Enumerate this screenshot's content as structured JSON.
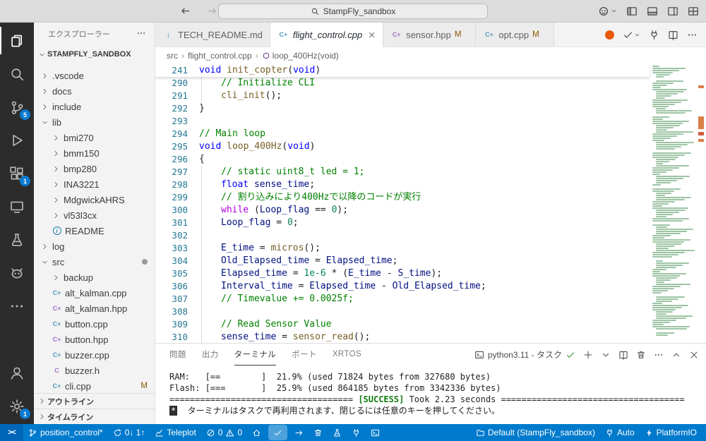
{
  "colors": {
    "status_bar": "#007acc",
    "activity_badge": "#0a7ad1",
    "git_modified": "#895503",
    "terminal_success": "#107c10",
    "tab_action_orange": "#e8590c"
  },
  "title_bar": {
    "search_value": "StampFly_sandbox",
    "nav": [
      {
        "name": "nav-back",
        "icon": "arrow-left-icon"
      },
      {
        "name": "nav-forward",
        "icon": "arrow-right-icon",
        "disabled": true
      }
    ],
    "right_actions": [
      {
        "name": "copilot-menu",
        "icon": "copilot-icon",
        "chevron": true
      },
      {
        "name": "toggle-primary-sidebar",
        "icon": "layout-sidebar-icon"
      },
      {
        "name": "toggle-panel",
        "icon": "layout-panel-icon"
      },
      {
        "name": "toggle-secondary-sidebar",
        "icon": "layout-sidebar-right-icon"
      },
      {
        "name": "customize-layout",
        "icon": "layout-grid-icon"
      }
    ]
  },
  "activity_bar": {
    "top": [
      {
        "name": "explorer",
        "icon": "files-icon",
        "active": true
      },
      {
        "name": "search",
        "icon": "search-icon"
      },
      {
        "name": "source-control",
        "icon": "source-control-icon",
        "badge": "5"
      },
      {
        "name": "run-and-debug",
        "icon": "run-debug-icon"
      },
      {
        "name": "extensions",
        "icon": "extensions-icon",
        "badge": "1"
      },
      {
        "name": "remote-explorer",
        "icon": "remote-explorer-icon"
      },
      {
        "name": "testing",
        "icon": "beaker-icon"
      },
      {
        "name": "platformio",
        "icon": "platformio-bug-icon"
      },
      {
        "name": "additional-views",
        "icon": "ellipsis-icon"
      }
    ],
    "bottom": [
      {
        "name": "accounts",
        "icon": "account-icon"
      },
      {
        "name": "settings",
        "icon": "gear-icon",
        "badge": "1"
      }
    ]
  },
  "sidebar": {
    "title": "エクスプローラー",
    "section": {
      "label": "STAMPFLY_SANDBOX",
      "state": "expanded"
    },
    "tree": [
      {
        "label": ".vscode",
        "kind": "folder",
        "state": "collapsed",
        "level": 1
      },
      {
        "label": "docs",
        "kind": "folder",
        "state": "collapsed",
        "level": 1
      },
      {
        "label": "include",
        "kind": "folder",
        "state": "collapsed",
        "level": 1
      },
      {
        "label": "lib",
        "kind": "folder",
        "state": "expanded",
        "level": 1
      },
      {
        "label": "bmi270",
        "kind": "folder",
        "state": "collapsed",
        "level": 2
      },
      {
        "label": "bmm150",
        "kind": "folder",
        "state": "collapsed",
        "level": 2
      },
      {
        "label": "bmp280",
        "kind": "folder",
        "state": "collapsed",
        "level": 2
      },
      {
        "label": "INA3221",
        "kind": "folder",
        "state": "collapsed",
        "level": 2
      },
      {
        "label": "MdgwickAHRS",
        "kind": "folder",
        "state": "collapsed",
        "level": 2
      },
      {
        "label": "vl53l3cx",
        "kind": "folder",
        "state": "collapsed",
        "level": 2
      },
      {
        "label": "README",
        "kind": "file",
        "icon": "info-icon",
        "level": 2
      },
      {
        "label": "log",
        "kind": "folder",
        "state": "collapsed",
        "level": 1
      },
      {
        "label": "src",
        "kind": "folder",
        "state": "expanded",
        "level": 1,
        "dot": true
      },
      {
        "label": "backup",
        "kind": "folder",
        "state": "collapsed",
        "level": 2
      },
      {
        "label": "alt_kalman.cpp",
        "kind": "file",
        "icon": "cpp-file-icon",
        "level": 2
      },
      {
        "label": "alt_kalman.hpp",
        "kind": "file",
        "icon": "hpp-file-icon",
        "level": 2
      },
      {
        "label": "button.cpp",
        "kind": "file",
        "icon": "cpp-file-icon",
        "level": 2
      },
      {
        "label": "button.hpp",
        "kind": "file",
        "icon": "hpp-file-icon",
        "level": 2
      },
      {
        "label": "buzzer.cpp",
        "kind": "file",
        "icon": "cpp-file-icon",
        "level": 2
      },
      {
        "label": "buzzer.h",
        "kind": "file",
        "icon": "h-file-icon",
        "level": 2
      },
      {
        "label": "cli.cpp",
        "kind": "file",
        "icon": "cpp-file-icon",
        "level": 2,
        "badge": "M"
      }
    ],
    "bottom_sections": [
      {
        "label": "アウトライン"
      },
      {
        "label": "タイムライン"
      }
    ]
  },
  "editor_tabs": {
    "tabs": [
      {
        "label": "TECH_README.md",
        "icon": "markdown-file-icon",
        "state": "inactive"
      },
      {
        "label": "flight_control.cpp",
        "icon": "cpp-file-icon",
        "state": "active",
        "preview": true,
        "closable": true
      },
      {
        "label": "sensor.hpp",
        "icon": "hpp-file-icon",
        "state": "inactive",
        "modified": "M"
      },
      {
        "label": "opt.cpp",
        "icon": "cpp-file-icon",
        "state": "inactive",
        "modified": "M"
      }
    ],
    "actions": [
      {
        "name": "platformio-task-indicator",
        "icon": "orange-circle-icon"
      },
      {
        "name": "run-build-task",
        "icon": "check-icon",
        "chevron": true
      },
      {
        "name": "pio-upload",
        "icon": "plug-icon"
      },
      {
        "name": "split-editor",
        "icon": "split-icon"
      },
      {
        "name": "more-editor-actions",
        "icon": "ellipsis-icon"
      }
    ]
  },
  "breadcrumb": {
    "items": [
      {
        "label": "src"
      },
      {
        "label": "flight_control.cpp"
      },
      {
        "label": "loop_400Hz(void)",
        "icon": "symbol-method-icon"
      }
    ]
  },
  "editor": {
    "sticky_line": {
      "n": "241",
      "i": 0,
      "t": [
        [
          "kw",
          "void"
        ],
        [
          "plain",
          " "
        ],
        [
          "fn",
          "init_copter"
        ],
        [
          "plain",
          "("
        ],
        [
          "kw",
          "void"
        ],
        [
          "plain",
          ")"
        ]
      ]
    },
    "lines": [
      {
        "n": "290",
        "i": 1,
        "t": [
          [
            "comment",
            "// Initialize CLI"
          ]
        ]
      },
      {
        "n": "291",
        "i": 1,
        "t": [
          [
            "fn",
            "cli_init"
          ],
          [
            "plain",
            "();"
          ]
        ]
      },
      {
        "n": "292",
        "i": 0,
        "t": [
          [
            "plain",
            "}"
          ]
        ]
      },
      {
        "n": "293",
        "i": 0,
        "t": []
      },
      {
        "n": "294",
        "i": 0,
        "t": [
          [
            "comment",
            "// Main loop"
          ]
        ]
      },
      {
        "n": "295",
        "i": 0,
        "t": [
          [
            "kw",
            "void"
          ],
          [
            "plain",
            " "
          ],
          [
            "fn",
            "loop_400Hz"
          ],
          [
            "plain",
            "("
          ],
          [
            "kw",
            "void"
          ],
          [
            "plain",
            ")"
          ]
        ]
      },
      {
        "n": "296",
        "i": 0,
        "t": [
          [
            "plain",
            "{"
          ]
        ]
      },
      {
        "n": "297",
        "i": 1,
        "t": [
          [
            "comment",
            "// static uint8_t led = 1;"
          ]
        ]
      },
      {
        "n": "298",
        "i": 1,
        "t": [
          [
            "kw",
            "float"
          ],
          [
            "plain",
            " "
          ],
          [
            "var",
            "sense_time"
          ],
          [
            "plain",
            ";"
          ]
        ]
      },
      {
        "n": "299",
        "i": 1,
        "t": [
          [
            "comment",
            "// 割り込みにより400Hzで以降のコードが実行"
          ]
        ]
      },
      {
        "n": "300",
        "i": 1,
        "t": [
          [
            "ctrl",
            "while"
          ],
          [
            "plain",
            " ("
          ],
          [
            "var",
            "Loop_flag"
          ],
          [
            "plain",
            " == "
          ],
          [
            "num",
            "0"
          ],
          [
            "plain",
            ");"
          ]
        ]
      },
      {
        "n": "301",
        "i": 1,
        "t": [
          [
            "var",
            "Loop_flag"
          ],
          [
            "plain",
            " = "
          ],
          [
            "num",
            "0"
          ],
          [
            "plain",
            ";"
          ]
        ]
      },
      {
        "n": "302",
        "i": 1,
        "t": []
      },
      {
        "n": "303",
        "i": 1,
        "t": [
          [
            "var",
            "E_time"
          ],
          [
            "plain",
            " = "
          ],
          [
            "fn",
            "micros"
          ],
          [
            "plain",
            "();"
          ]
        ]
      },
      {
        "n": "304",
        "i": 1,
        "t": [
          [
            "var",
            "Old_Elapsed_time"
          ],
          [
            "plain",
            " = "
          ],
          [
            "var",
            "Elapsed_time"
          ],
          [
            "plain",
            ";"
          ]
        ]
      },
      {
        "n": "305",
        "i": 1,
        "t": [
          [
            "var",
            "Elapsed_time"
          ],
          [
            "plain",
            " = "
          ],
          [
            "num",
            "1e-6"
          ],
          [
            "plain",
            " * ("
          ],
          [
            "var",
            "E_time"
          ],
          [
            "plain",
            " - "
          ],
          [
            "var",
            "S_time"
          ],
          [
            "plain",
            ");"
          ]
        ]
      },
      {
        "n": "306",
        "i": 1,
        "t": [
          [
            "var",
            "Interval_time"
          ],
          [
            "plain",
            " = "
          ],
          [
            "var",
            "Elapsed_time"
          ],
          [
            "plain",
            " - "
          ],
          [
            "var",
            "Old_Elapsed_time"
          ],
          [
            "plain",
            ";"
          ]
        ]
      },
      {
        "n": "307",
        "i": 1,
        "t": [
          [
            "comment",
            "// Timevalue += 0.0025f;"
          ]
        ]
      },
      {
        "n": "308",
        "i": 1,
        "t": []
      },
      {
        "n": "309",
        "i": 1,
        "t": [
          [
            "comment",
            "// Read Sensor Value"
          ]
        ]
      },
      {
        "n": "310",
        "i": 1,
        "t": [
          [
            "var",
            "sense_time"
          ],
          [
            "plain",
            " = "
          ],
          [
            "fn",
            "sensor_read"
          ],
          [
            "plain",
            "();"
          ]
        ]
      }
    ]
  },
  "panel": {
    "tabs": [
      {
        "label": "問題"
      },
      {
        "label": "出力"
      },
      {
        "label": "ターミナル",
        "active": true
      },
      {
        "label": "ポート"
      },
      {
        "label": "XRTOS"
      }
    ],
    "task": {
      "icon": "terminal-icon",
      "label": "python3.11 - タスク",
      "status_icon": "check-icon"
    },
    "controls": [
      {
        "name": "new-terminal",
        "icon": "plus-icon"
      },
      {
        "name": "terminal-picker",
        "icon": "chevron-down-icon"
      },
      {
        "name": "split-terminal",
        "icon": "split-icon"
      },
      {
        "name": "kill-terminal",
        "icon": "trash-icon"
      },
      {
        "name": "more-terminal-actions",
        "icon": "ellipsis-icon"
      },
      {
        "name": "maximize-panel",
        "icon": "chevron-up-icon"
      },
      {
        "name": "close-panel",
        "icon": "close-icon"
      }
    ],
    "terminal_lines": [
      {
        "segments": [
          [
            "plain",
            "RAM:   [==        ]  21.9% (used 71824 bytes from 327680 bytes)"
          ]
        ]
      },
      {
        "segments": [
          [
            "plain",
            "Flash: [===       ]  25.9% (used 864185 bytes from 3342336 bytes)"
          ]
        ]
      },
      {
        "segments": [
          [
            "plain",
            "==================================== "
          ],
          [
            "success",
            "[SUCCESS]"
          ],
          [
            "plain",
            " Took 2.23 seconds ===================================="
          ]
        ]
      },
      {
        "segments": [
          [
            "inverse",
            "*"
          ],
          [
            "plain",
            "  ターミナルはタスクで再利用されます、閉じるには任意のキーを押してください。"
          ]
        ]
      }
    ]
  },
  "status_bar": {
    "remote": {
      "label": "><"
    },
    "left": [
      {
        "name": "git-branch",
        "icon": "branch-icon",
        "label": "position_control*"
      },
      {
        "name": "sync-changes",
        "icon": "sync-icon",
        "label": "0↓ 1↑"
      },
      {
        "name": "teleplot",
        "icon": "graph-icon",
        "label": "Teleplot"
      },
      {
        "name": "problems",
        "icon": "error-icon",
        "label": "0",
        "icon2": "warning-icon",
        "label2": "0"
      },
      {
        "name": "pio-home",
        "icon": "home-icon"
      },
      {
        "name": "pio-build",
        "icon": "check-icon",
        "highlight": true
      },
      {
        "name": "pio-upload",
        "icon": "arrow-right-icon"
      },
      {
        "name": "pio-clean",
        "icon": "trash-icon"
      },
      {
        "name": "pio-test",
        "icon": "flask-icon"
      },
      {
        "name": "pio-serial-monitor",
        "icon": "plug-icon"
      },
      {
        "name": "pio-new-terminal",
        "icon": "terminal-icon"
      }
    ],
    "right": [
      {
        "name": "pio-project-env",
        "icon": "folder-icon",
        "label": "Default (StampFly_sandbox)"
      },
      {
        "name": "pio-serial-port",
        "icon": "plug-icon",
        "label": "Auto"
      },
      {
        "name": "platformio-ide",
        "icon": "bolt-icon",
        "label": "PlatformIO"
      }
    ]
  }
}
